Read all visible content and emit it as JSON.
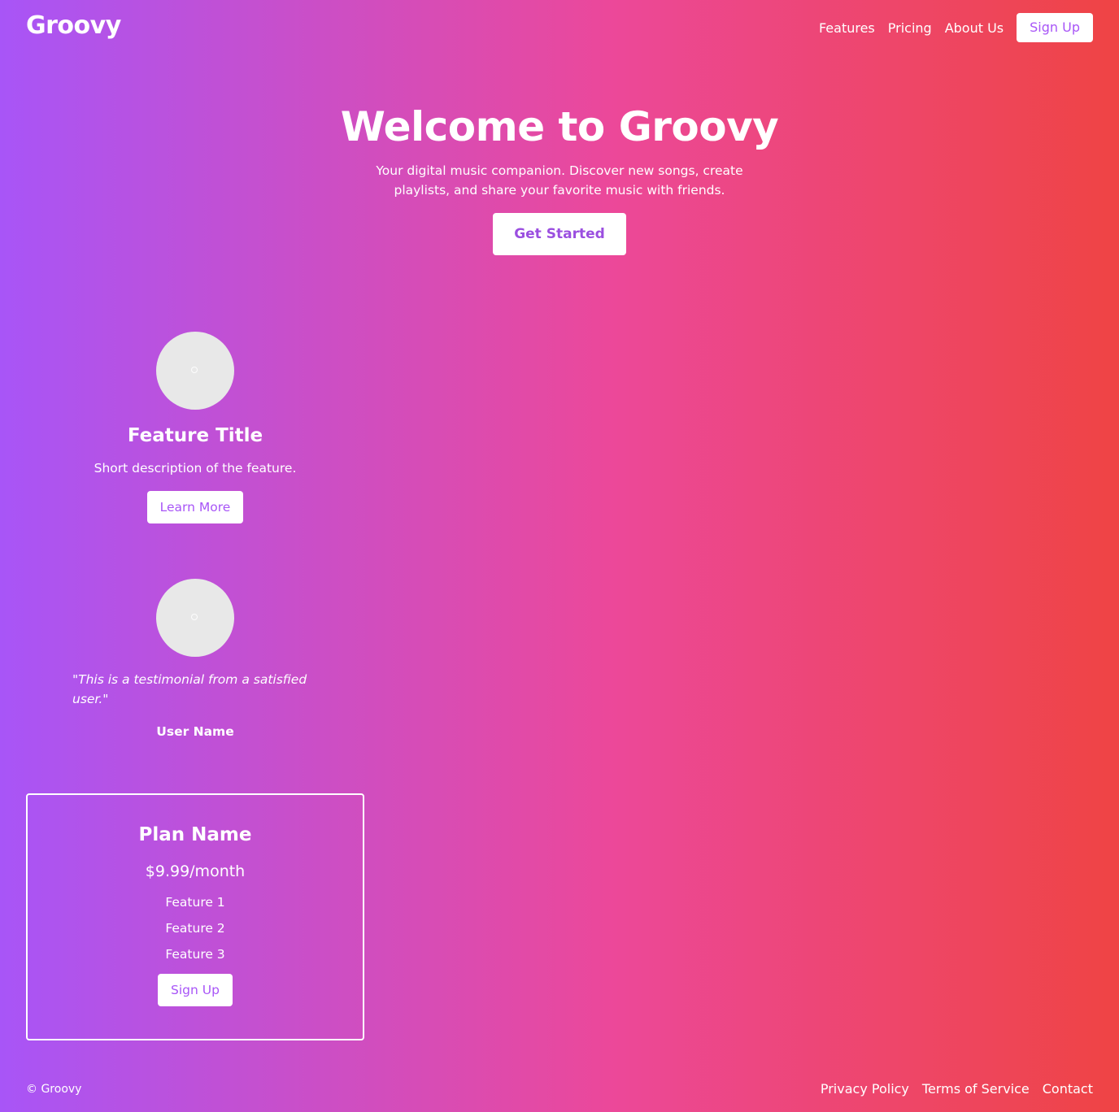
{
  "header": {
    "logo": "Groovy",
    "nav": [
      "Features",
      "Pricing",
      "About Us"
    ],
    "signup_label": "Sign Up"
  },
  "hero": {
    "title": "Welcome to Groovy",
    "subtitle": "Your digital music companion. Discover new songs, create playlists, and share your favorite music with friends.",
    "cta_label": "Get Started"
  },
  "feature": {
    "title": "Feature Title",
    "description": "Short description of the feature.",
    "button_label": "Learn More"
  },
  "testimonial": {
    "quote": "\"This is a testimonial from a satisfied user.\"",
    "user_name": "User Name"
  },
  "pricing": {
    "plan_name": "Plan Name",
    "price": "$9.99/month",
    "features": [
      "Feature 1",
      "Feature 2",
      "Feature 3"
    ],
    "button_label": "Sign Up"
  },
  "footer": {
    "copyright": "© Groovy",
    "links": [
      "Privacy Policy",
      "Terms of Service",
      "Contact"
    ]
  },
  "colors": {
    "gradient_start": "#a855f7",
    "gradient_mid": "#ec4899",
    "gradient_end": "#ef4444",
    "button_text": "#a855f7",
    "placeholder_image": "#e8e8e8"
  },
  "icons": {
    "feature_image": "image-placeholder-icon",
    "testimonial_avatar": "avatar-placeholder-icon"
  }
}
